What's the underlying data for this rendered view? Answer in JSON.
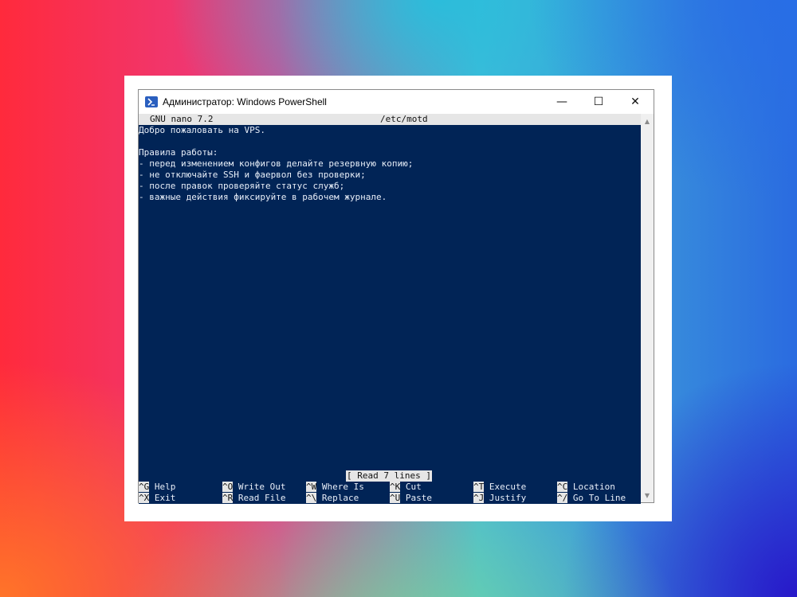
{
  "window": {
    "title": "Администратор: Windows PowerShell",
    "min_glyph": "—",
    "max_glyph": "☐",
    "close_glyph": "✕"
  },
  "nano": {
    "version": "GNU nano 7.2",
    "filename": "/etc/motd",
    "lines": [
      "Добро пожаловать на VPS.",
      "",
      "Правила работы:",
      "- перед изменением конфигов делайте резервную копию;",
      "- не отключайте SSH и фаервол без проверки;",
      "- после правок проверяйте статус служб;",
      "- важные действия фиксируйте в рабочем журнале."
    ],
    "status": "[ Read 7 lines ]",
    "shortcuts_row1": [
      {
        "key": "^G",
        "label": "Help"
      },
      {
        "key": "^O",
        "label": "Write Out"
      },
      {
        "key": "^W",
        "label": "Where Is"
      },
      {
        "key": "^K",
        "label": "Cut"
      },
      {
        "key": "^T",
        "label": "Execute"
      },
      {
        "key": "^C",
        "label": "Location"
      }
    ],
    "shortcuts_row2": [
      {
        "key": "^X",
        "label": "Exit"
      },
      {
        "key": "^R",
        "label": "Read File"
      },
      {
        "key": "^\\",
        "label": "Replace"
      },
      {
        "key": "^U",
        "label": "Paste"
      },
      {
        "key": "^J",
        "label": "Justify"
      },
      {
        "key": "^/",
        "label": "Go To Line"
      }
    ]
  },
  "colors": {
    "console_bg": "#012456",
    "console_fg": "#e8eef8",
    "nano_bar": "#e6e6e6"
  }
}
